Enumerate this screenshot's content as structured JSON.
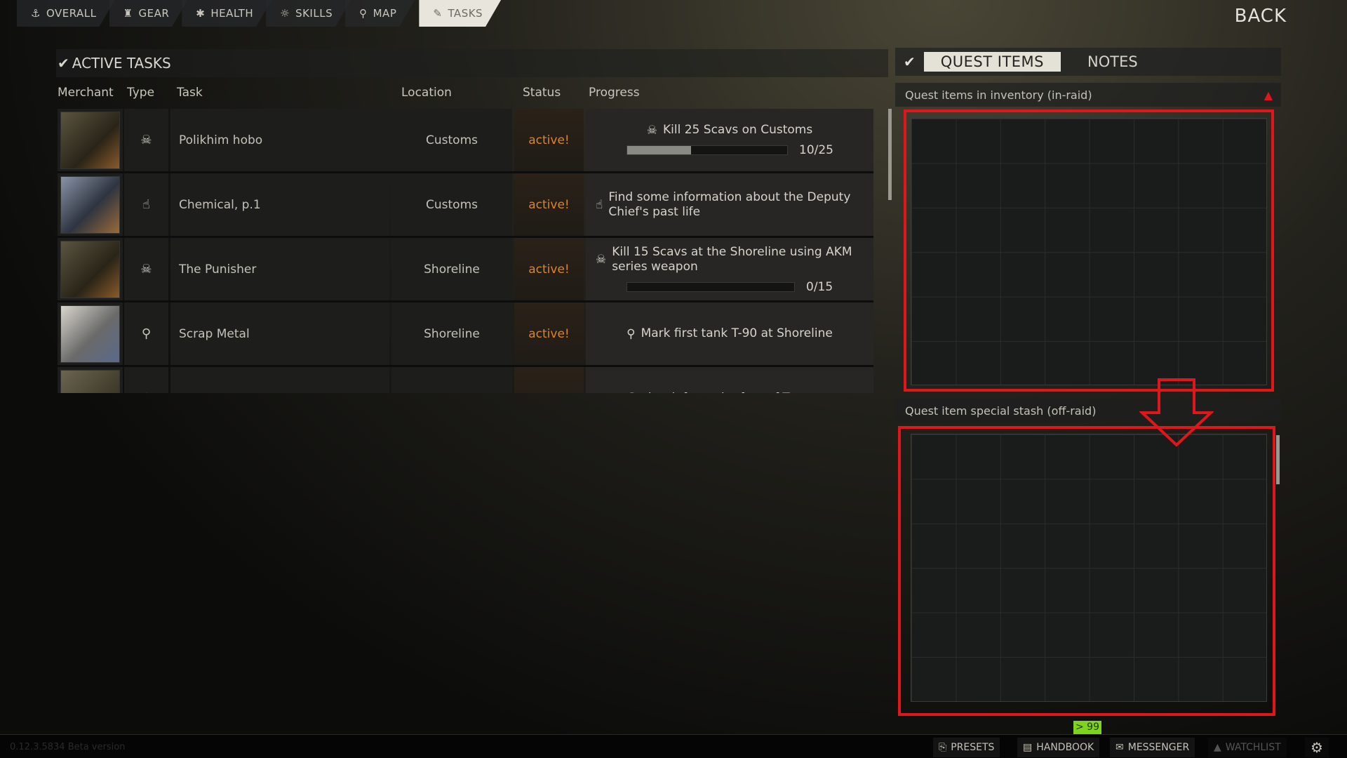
{
  "nav": {
    "tabs": [
      {
        "label": "OVERALL",
        "icon": "overall-icon"
      },
      {
        "label": "GEAR",
        "icon": "gear-equipment-icon"
      },
      {
        "label": "HEALTH",
        "icon": "health-icon"
      },
      {
        "label": "SKILLS",
        "icon": "skills-icon"
      },
      {
        "label": "MAP",
        "icon": "map-pin-icon"
      },
      {
        "label": "TASKS",
        "icon": "tasks-icon",
        "active": true
      }
    ],
    "back": "BACK"
  },
  "tasks": {
    "title": "ACTIVE TASKS",
    "columns": [
      "Merchant",
      "Type",
      "Task",
      "Location",
      "Status",
      "Progress"
    ],
    "rows": [
      {
        "merchant": "prapor",
        "type": "elimination",
        "task": "Polikhim hobo",
        "location": "Customs",
        "status": "active!",
        "objective": "Kill 25 Scavs on Customs",
        "progress": "10/25",
        "progress_fraction": 0.4
      },
      {
        "merchant": "mechanic",
        "type": "pickup",
        "task": "Chemical, p.1",
        "location": "Customs",
        "status": "active!",
        "objective": "Find some information about the Deputy Chief's past life"
      },
      {
        "merchant": "prapor",
        "type": "elimination",
        "task": "The Punisher",
        "location": "Shoreline",
        "status": "active!",
        "objective": "Kill 15 Scavs at the Shoreline using AKM series weapon",
        "progress": "0/15",
        "progress_fraction": 0
      },
      {
        "merchant": "skier",
        "type": "marking",
        "task": "Scrap Metal",
        "location": "Shoreline",
        "status": "active!",
        "objective": "Mark first tank T-90 at Shoreline"
      },
      {
        "merchant": "peacekeeper",
        "type": "marking",
        "task": "",
        "location": "",
        "status": "",
        "objective": "Gather info on the fate of Terragroup"
      }
    ]
  },
  "right": {
    "tab_active": "QUEST ITEMS",
    "tab_other": "NOTES",
    "inventory_label": "Quest items in inventory (in-raid)",
    "stash_label": "Quest item special stash (off-raid)",
    "warning_color": "#e0161d",
    "highlight_color": "#e0161d"
  },
  "footer": {
    "version": "0.12.3.5834 Beta version",
    "badge": "> 99",
    "badge_color": "#7ed321",
    "buttons": [
      "PRESETS",
      "HANDBOOK",
      "MESSENGER",
      "WATCHLIST"
    ]
  }
}
